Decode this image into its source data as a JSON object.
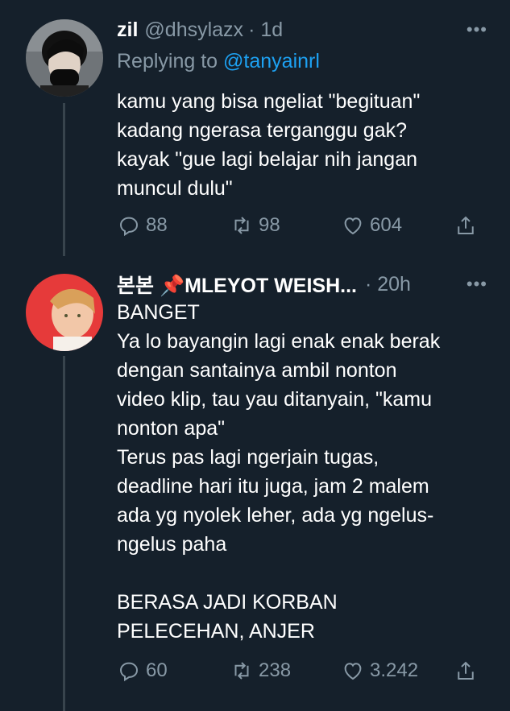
{
  "tweets": [
    {
      "display_name": "zil",
      "handle": "@dhsylazx",
      "time": "· 1d",
      "replying_prefix": "Replying to ",
      "replying_to": "@tanyainrl",
      "text": "kamu yang bisa ngeliat \"begituan\"\nkadang ngerasa terganggu gak?\nkayak \"gue lagi belajar nih jangan\nmuncul dulu\"",
      "replies": "88",
      "retweets": "98",
      "likes": "604"
    },
    {
      "display_name": "본본 📌MLEYOT WEISH...",
      "time": "· 20h",
      "text": "BANGET\nYa lo bayangin lagi enak enak berak\ndengan santainya ambil nonton\nvideo klip, tau yau ditanyain, \"kamu\nnonton apa\"\nTerus pas lagi ngerjain tugas,\ndeadline hari itu juga, jam 2 malem\nada yg nyolek leher, ada yg ngelus-\nngelus paha\n\nBERASA JADI KORBAN\nPELECEHAN, ANJER",
      "replies": "60",
      "retweets": "238",
      "likes": "3.242"
    }
  ],
  "more_symbol": "•••",
  "colors": {
    "background": "#15202b",
    "muted": "#8899a6",
    "link": "#1da1f2",
    "thread_line": "#38444d"
  },
  "icons": [
    "reply-icon",
    "retweet-icon",
    "like-icon",
    "share-icon",
    "more-icon"
  ]
}
